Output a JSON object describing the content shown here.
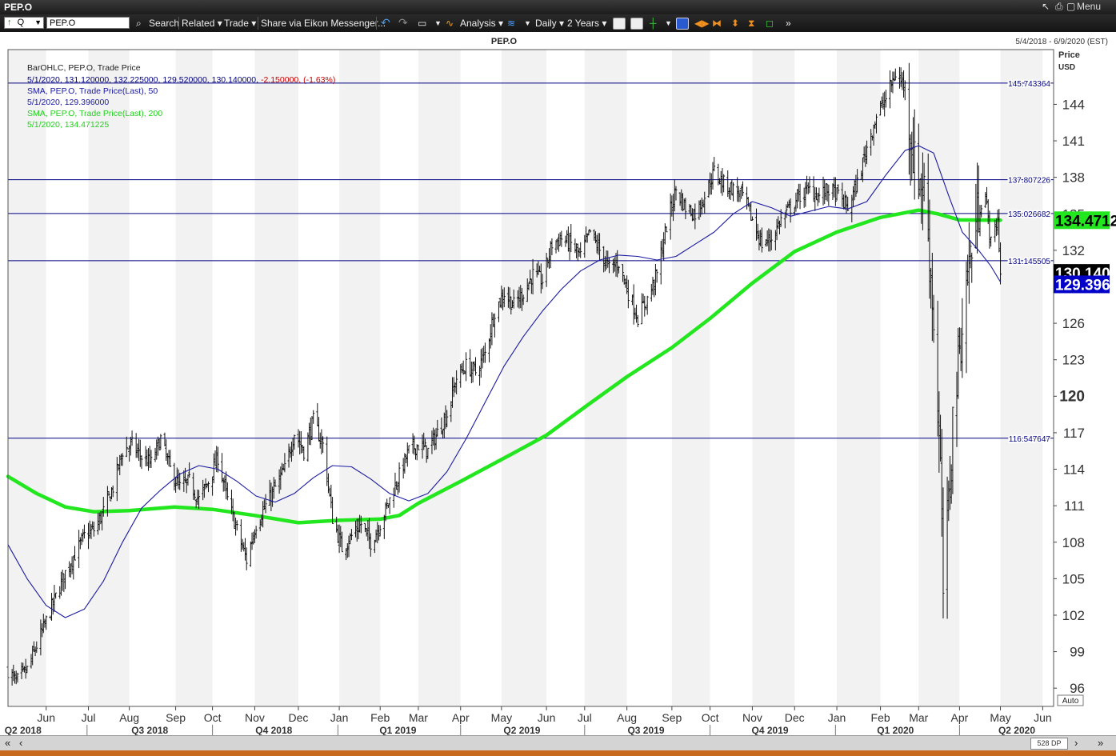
{
  "window": {
    "title": "PEP.O",
    "back_label": "↖",
    "print_label": "⎙",
    "restore_label": "▢",
    "menu_label": "Menu"
  },
  "toolbar": {
    "q_label": "Q",
    "ric_value": "PEP.O",
    "search_label": "Search",
    "related_label": "Related ▾",
    "trade_label": "Trade ▾",
    "share_label": "Share via Eikon Messenger...",
    "analysis_label": "Analysis ▾",
    "interval_label": "Daily ▾",
    "range_label": "2 Years ▾"
  },
  "chart_header": {
    "title": "PEP.O",
    "date_range": "5/4/2018 - 6/9/2020 (EST)"
  },
  "legend": {
    "line1": "BarOHLC, PEP.O, Trade Price",
    "line2_prefix": "5/1/2020, 131.120000, 132.225000, 129.520000, 130.140000, ",
    "line2_change": "-2.150000, (-1.63%)",
    "line3": "SMA, PEP.O, Trade Price(Last),  50",
    "line4": "5/1/2020, 129.396000",
    "line5": "SMA, PEP.O, Trade Price(Last),  200",
    "line6": "5/1/2020, 134.471225"
  },
  "axis": {
    "price_label": "Price",
    "currency_label": "USD",
    "auto_label": "Auto"
  },
  "status": {
    "dp_label": "528 DP"
  },
  "colors": {
    "bar": "#111111",
    "sma50": "#1a1aa0",
    "sma200": "#22e61e",
    "hline": "#000080",
    "last_price_bg": "#000000",
    "sma50_bg": "#0000c8",
    "sma200_bg": "#22e61e",
    "band": "#f2f2f2",
    "change": "#cc0000"
  },
  "chart_data": {
    "type": "ohlc",
    "title": "PEP.O",
    "ylabel": "Price USD",
    "ylim": [
      94.5,
      148.5
    ],
    "x_range": [
      "2018-05-04",
      "2020-06-09"
    ],
    "yticks": [
      96,
      99,
      102,
      105,
      108,
      111,
      114,
      117,
      120,
      123,
      126,
      129,
      132,
      135,
      138,
      141,
      144
    ],
    "bold_tick": 120,
    "month_ticks": [
      {
        "label": "Jun",
        "date": "2018-06-01"
      },
      {
        "label": "Jul",
        "date": "2018-07-02"
      },
      {
        "label": "Aug",
        "date": "2018-08-01"
      },
      {
        "label": "Sep",
        "date": "2018-09-04"
      },
      {
        "label": "Oct",
        "date": "2018-10-01"
      },
      {
        "label": "Nov",
        "date": "2018-11-01"
      },
      {
        "label": "Dec",
        "date": "2018-12-03"
      },
      {
        "label": "Jan",
        "date": "2019-01-02"
      },
      {
        "label": "Feb",
        "date": "2019-02-01"
      },
      {
        "label": "Mar",
        "date": "2019-03-01"
      },
      {
        "label": "Apr",
        "date": "2019-04-01"
      },
      {
        "label": "May",
        "date": "2019-05-01"
      },
      {
        "label": "Jun",
        "date": "2019-06-03"
      },
      {
        "label": "Jul",
        "date": "2019-07-01"
      },
      {
        "label": "Aug",
        "date": "2019-08-01"
      },
      {
        "label": "Sep",
        "date": "2019-09-03"
      },
      {
        "label": "Oct",
        "date": "2019-10-01"
      },
      {
        "label": "Nov",
        "date": "2019-11-01"
      },
      {
        "label": "Dec",
        "date": "2019-12-02"
      },
      {
        "label": "Jan",
        "date": "2020-01-02"
      },
      {
        "label": "Feb",
        "date": "2020-02-03"
      },
      {
        "label": "Mar",
        "date": "2020-03-02"
      },
      {
        "label": "Apr",
        "date": "2020-04-01"
      },
      {
        "label": "May",
        "date": "2020-05-01"
      },
      {
        "label": "Jun",
        "date": "2020-06-01"
      }
    ],
    "quarter_ticks": [
      {
        "label": "Q2 2018",
        "date": "2018-05-15"
      },
      {
        "label": "Q3 2018",
        "date": "2018-08-16"
      },
      {
        "label": "Q4 2018",
        "date": "2018-11-15"
      },
      {
        "label": "Q1 2019",
        "date": "2019-02-14"
      },
      {
        "label": "Q2 2019",
        "date": "2019-05-16"
      },
      {
        "label": "Q3 2019",
        "date": "2019-08-15"
      },
      {
        "label": "Q4 2019",
        "date": "2019-11-14"
      },
      {
        "label": "Q1 2020",
        "date": "2020-02-14"
      },
      {
        "label": "Q2 2020",
        "date": "2020-05-13"
      }
    ],
    "hlines": [
      {
        "value": 145.743364,
        "label": "145.743364"
      },
      {
        "value": 137.807226,
        "label": "137.807226"
      },
      {
        "value": 135.026682,
        "label": "135.026682"
      },
      {
        "value": 131.145505,
        "label": "131.145505"
      },
      {
        "value": 116.547647,
        "label": "116.547647"
      }
    ],
    "last_values": [
      {
        "name": "SMA 200",
        "value": 134.471225,
        "label": "134.4712"
      },
      {
        "name": "Last",
        "value": 130.14,
        "label": "130.140"
      },
      {
        "name": "SMA 50",
        "value": 129.396,
        "label": "129.3960"
      }
    ],
    "price_path": [
      [
        "2018-05-04",
        97.5
      ],
      [
        "2018-05-10",
        96.5
      ],
      [
        "2018-05-18",
        97.5
      ],
      [
        "2018-05-25",
        99.5
      ],
      [
        "2018-06-01",
        101.5
      ],
      [
        "2018-06-08",
        103.5
      ],
      [
        "2018-06-15",
        105.5
      ],
      [
        "2018-06-22",
        107.0
      ],
      [
        "2018-06-29",
        108.5
      ],
      [
        "2018-07-06",
        109.0
      ],
      [
        "2018-07-13",
        110.5
      ],
      [
        "2018-07-20",
        112.5
      ],
      [
        "2018-07-27",
        115.5
      ],
      [
        "2018-08-03",
        116.0
      ],
      [
        "2018-08-10",
        115.0
      ],
      [
        "2018-08-17",
        114.5
      ],
      [
        "2018-08-24",
        116.5
      ],
      [
        "2018-08-31",
        114.0
      ],
      [
        "2018-09-07",
        112.5
      ],
      [
        "2018-09-14",
        113.0
      ],
      [
        "2018-09-21",
        111.5
      ],
      [
        "2018-09-28",
        113.0
      ],
      [
        "2018-10-05",
        115.0
      ],
      [
        "2018-10-12",
        111.5
      ],
      [
        "2018-10-19",
        109.0
      ],
      [
        "2018-10-26",
        106.5
      ],
      [
        "2018-11-02",
        109.5
      ],
      [
        "2018-11-09",
        111.0
      ],
      [
        "2018-11-16",
        112.5
      ],
      [
        "2018-11-23",
        114.0
      ],
      [
        "2018-11-30",
        117.0
      ],
      [
        "2018-12-07",
        115.5
      ],
      [
        "2018-12-14",
        118.0
      ],
      [
        "2018-12-21",
        116.0
      ],
      [
        "2018-12-28",
        110.0
      ],
      [
        "2019-01-04",
        107.5
      ],
      [
        "2019-01-11",
        108.5
      ],
      [
        "2019-01-18",
        109.5
      ],
      [
        "2019-01-25",
        108.0
      ],
      [
        "2019-02-01",
        109.5
      ],
      [
        "2019-02-08",
        111.5
      ],
      [
        "2019-02-15",
        113.5
      ],
      [
        "2019-02-22",
        115.5
      ],
      [
        "2019-03-01",
        116.0
      ],
      [
        "2019-03-08",
        115.5
      ],
      [
        "2019-03-15",
        117.0
      ],
      [
        "2019-03-22",
        118.5
      ],
      [
        "2019-03-29",
        121.5
      ],
      [
        "2019-04-05",
        122.5
      ],
      [
        "2019-04-12",
        122.0
      ],
      [
        "2019-04-19",
        123.5
      ],
      [
        "2019-04-26",
        127.0
      ],
      [
        "2019-05-03",
        128.5
      ],
      [
        "2019-05-10",
        127.5
      ],
      [
        "2019-05-17",
        128.5
      ],
      [
        "2019-05-24",
        130.0
      ],
      [
        "2019-05-31",
        129.5
      ],
      [
        "2019-06-07",
        132.5
      ],
      [
        "2019-06-14",
        133.0
      ],
      [
        "2019-06-21",
        132.5
      ],
      [
        "2019-06-28",
        131.5
      ],
      [
        "2019-07-05",
        133.5
      ],
      [
        "2019-07-12",
        132.0
      ],
      [
        "2019-07-19",
        130.5
      ],
      [
        "2019-07-26",
        131.0
      ],
      [
        "2019-08-02",
        128.5
      ],
      [
        "2019-08-09",
        126.5
      ],
      [
        "2019-08-16",
        128.0
      ],
      [
        "2019-08-23",
        130.0
      ],
      [
        "2019-08-30",
        134.0
      ],
      [
        "2019-09-06",
        137.0
      ],
      [
        "2019-09-13",
        135.5
      ],
      [
        "2019-09-20",
        135.0
      ],
      [
        "2019-09-27",
        136.5
      ],
      [
        "2019-10-04",
        138.5
      ],
      [
        "2019-10-11",
        137.5
      ],
      [
        "2019-10-18",
        137.0
      ],
      [
        "2019-10-25",
        136.5
      ],
      [
        "2019-11-01",
        134.5
      ],
      [
        "2019-11-08",
        132.5
      ],
      [
        "2019-11-15",
        133.0
      ],
      [
        "2019-11-22",
        134.5
      ],
      [
        "2019-11-29",
        135.5
      ],
      [
        "2019-12-06",
        136.5
      ],
      [
        "2019-12-13",
        137.0
      ],
      [
        "2019-12-20",
        136.5
      ],
      [
        "2019-12-27",
        137.0
      ],
      [
        "2020-01-03",
        136.5
      ],
      [
        "2020-01-10",
        135.5
      ],
      [
        "2020-01-17",
        137.5
      ],
      [
        "2020-01-24",
        140.5
      ],
      [
        "2020-01-31",
        143.0
      ],
      [
        "2020-02-07",
        144.5
      ],
      [
        "2020-02-14",
        146.5
      ],
      [
        "2020-02-21",
        145.5
      ],
      [
        "2020-02-28",
        139.0
      ],
      [
        "2020-03-06",
        137.0
      ],
      [
        "2020-03-10",
        132.0
      ],
      [
        "2020-03-13",
        126.0
      ],
      [
        "2020-03-18",
        114.0
      ],
      [
        "2020-03-20",
        104.0
      ],
      [
        "2020-03-24",
        111.0
      ],
      [
        "2020-03-27",
        118.0
      ],
      [
        "2020-04-01",
        124.0
      ],
      [
        "2020-04-08",
        131.0
      ],
      [
        "2020-04-15",
        135.5
      ],
      [
        "2020-04-20",
        136.5
      ],
      [
        "2020-04-24",
        132.5
      ],
      [
        "2020-04-29",
        134.5
      ],
      [
        "2020-05-01",
        130.14
      ]
    ],
    "sma50": [
      [
        "2018-05-04",
        107.8
      ],
      [
        "2018-05-18",
        105.0
      ],
      [
        "2018-06-01",
        102.8
      ],
      [
        "2018-06-15",
        101.8
      ],
      [
        "2018-06-29",
        102.5
      ],
      [
        "2018-07-13",
        104.8
      ],
      [
        "2018-07-27",
        108.0
      ],
      [
        "2018-08-10",
        110.8
      ],
      [
        "2018-08-24",
        112.3
      ],
      [
        "2018-09-07",
        113.6
      ],
      [
        "2018-09-21",
        114.3
      ],
      [
        "2018-10-05",
        114.0
      ],
      [
        "2018-10-19",
        113.0
      ],
      [
        "2018-11-02",
        111.8
      ],
      [
        "2018-11-16",
        111.3
      ],
      [
        "2018-11-30",
        112.0
      ],
      [
        "2018-12-14",
        113.3
      ],
      [
        "2018-12-28",
        114.3
      ],
      [
        "2019-01-11",
        114.2
      ],
      [
        "2019-01-25",
        113.2
      ],
      [
        "2019-02-08",
        112.0
      ],
      [
        "2019-02-22",
        111.4
      ],
      [
        "2019-03-08",
        112.0
      ],
      [
        "2019-03-22",
        113.8
      ],
      [
        "2019-04-05",
        116.5
      ],
      [
        "2019-04-19",
        119.5
      ],
      [
        "2019-05-03",
        122.5
      ],
      [
        "2019-05-17",
        124.9
      ],
      [
        "2019-05-31",
        127.0
      ],
      [
        "2019-06-14",
        128.8
      ],
      [
        "2019-06-28",
        130.3
      ],
      [
        "2019-07-12",
        131.2
      ],
      [
        "2019-07-26",
        131.6
      ],
      [
        "2019-08-09",
        131.5
      ],
      [
        "2019-08-23",
        131.2
      ],
      [
        "2019-09-06",
        131.5
      ],
      [
        "2019-09-20",
        132.5
      ],
      [
        "2019-10-04",
        133.5
      ],
      [
        "2019-10-18",
        135.0
      ],
      [
        "2019-11-01",
        136.0
      ],
      [
        "2019-11-15",
        135.5
      ],
      [
        "2019-11-29",
        134.8
      ],
      [
        "2019-12-13",
        135.2
      ],
      [
        "2019-12-27",
        135.6
      ],
      [
        "2020-01-10",
        135.4
      ],
      [
        "2020-01-24",
        136.0
      ],
      [
        "2020-02-07",
        138.2
      ],
      [
        "2020-02-21",
        140.2
      ],
      [
        "2020-03-02",
        140.6
      ],
      [
        "2020-03-13",
        140.0
      ],
      [
        "2020-03-24",
        136.5
      ],
      [
        "2020-04-03",
        133.5
      ],
      [
        "2020-04-15",
        132.0
      ],
      [
        "2020-04-24",
        130.7
      ],
      [
        "2020-05-01",
        129.4
      ]
    ],
    "sma200": [
      [
        "2018-05-04",
        113.4
      ],
      [
        "2018-05-25",
        112.0
      ],
      [
        "2018-06-15",
        110.9
      ],
      [
        "2018-07-06",
        110.5
      ],
      [
        "2018-08-01",
        110.6
      ],
      [
        "2018-09-03",
        110.9
      ],
      [
        "2018-10-01",
        110.7
      ],
      [
        "2018-11-01",
        110.2
      ],
      [
        "2018-12-03",
        109.6
      ],
      [
        "2019-01-02",
        109.8
      ],
      [
        "2019-02-01",
        109.9
      ],
      [
        "2019-02-15",
        110.2
      ],
      [
        "2019-03-01",
        111.2
      ],
      [
        "2019-04-01",
        113.0
      ],
      [
        "2019-05-01",
        114.8
      ],
      [
        "2019-06-03",
        116.8
      ],
      [
        "2019-07-01",
        119.1
      ],
      [
        "2019-08-01",
        121.6
      ],
      [
        "2019-09-03",
        124.0
      ],
      [
        "2019-10-01",
        126.4
      ],
      [
        "2019-11-01",
        129.3
      ],
      [
        "2019-12-02",
        131.9
      ],
      [
        "2020-01-02",
        133.5
      ],
      [
        "2020-02-03",
        134.7
      ],
      [
        "2020-03-02",
        135.3
      ],
      [
        "2020-03-16",
        135.0
      ],
      [
        "2020-04-01",
        134.5
      ],
      [
        "2020-05-01",
        134.47
      ]
    ]
  }
}
